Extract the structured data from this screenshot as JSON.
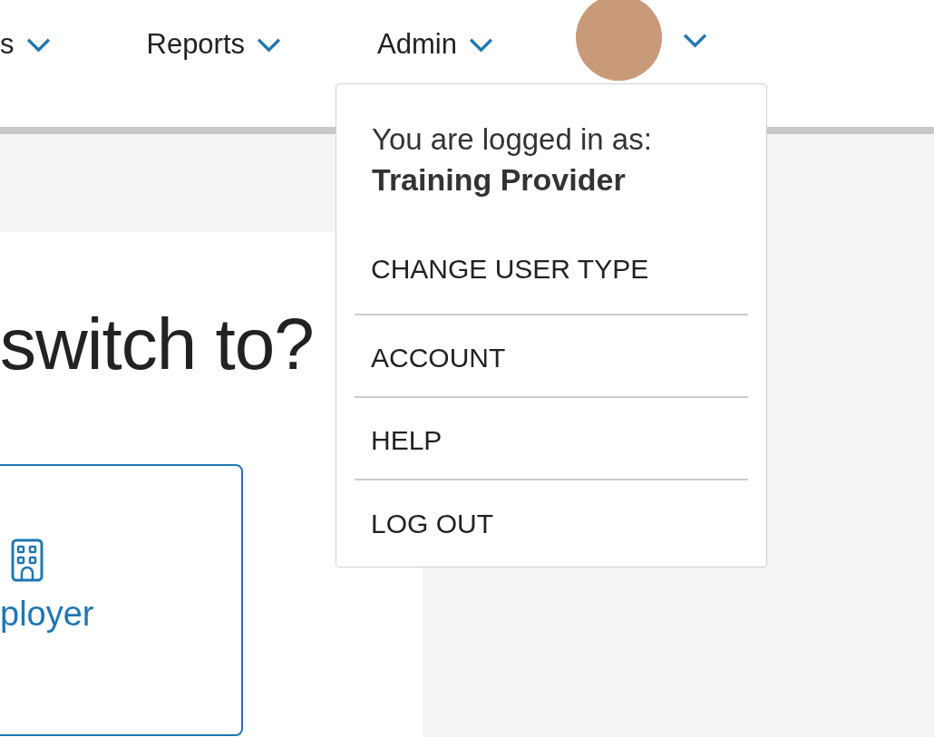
{
  "nav": {
    "items": [
      {
        "label": "s"
      },
      {
        "label": "Reports"
      },
      {
        "label": "Admin"
      }
    ],
    "account_menu": {
      "expanded": true
    }
  },
  "account_dropdown": {
    "intro": "You are logged in as:",
    "user_type": "Training Provider",
    "items": [
      {
        "label": "CHANGE USER TYPE"
      },
      {
        "label": "ACCOUNT"
      },
      {
        "label": "HELP"
      },
      {
        "label": "LOG OUT"
      }
    ]
  },
  "main": {
    "heading": "switch to?",
    "option_card": {
      "label": "ployer"
    }
  }
}
